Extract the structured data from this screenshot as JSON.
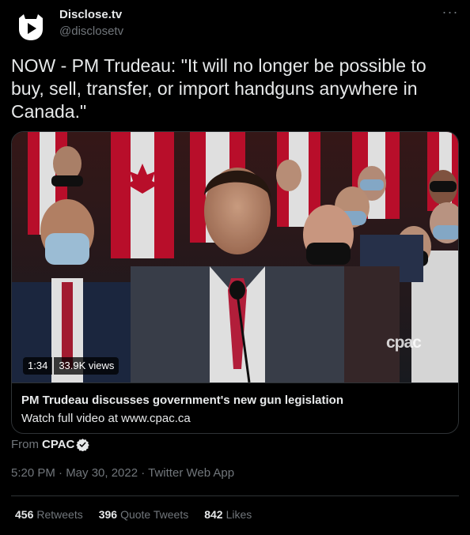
{
  "author": {
    "display_name": "Disclose.tv",
    "handle": "@disclosetv",
    "avatar_icon": "disclose-tv-logo-icon"
  },
  "more_icon": "more-options-icon",
  "tweet": {
    "text": "NOW - PM Trudeau: \"It will no longer be possible to buy, sell, transfer, or import handguns anywhere in Canada.\""
  },
  "media": {
    "duration": "1:34",
    "views": "33.9K views",
    "watermark": "cpac",
    "title": "PM Trudeau discusses government's new gun legislation",
    "subtitle": "Watch full video at www.cpac.ca"
  },
  "from": {
    "prefix": "From",
    "name": "CPAC",
    "badge_icon": "verified-badge-icon"
  },
  "timestamp": "5:20 PM · May 30, 2022 · Twitter Web App",
  "stats": {
    "retweets_count": "456",
    "retweets_label": "Retweets",
    "quotes_count": "396",
    "quotes_label": "Quote Tweets",
    "likes_count": "842",
    "likes_label": "Likes"
  },
  "colors": {
    "background": "#000000",
    "text": "#e7e9ea",
    "muted": "#71767b",
    "border": "#2f3336"
  }
}
